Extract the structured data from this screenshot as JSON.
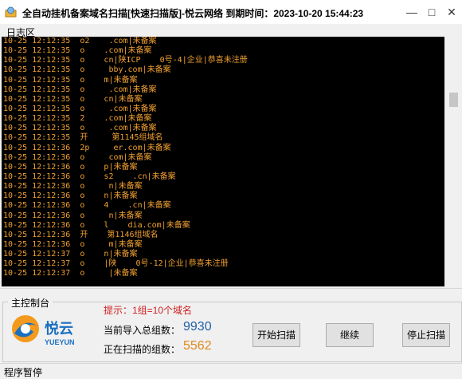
{
  "window": {
    "title": "全自动挂机备案域名扫描[快速扫描版]-悦云网络  到期时间：2023-10-20 15:44:23",
    "minimize": "—",
    "maximize": "□",
    "close": "✕"
  },
  "log_panel": {
    "label": "日志区",
    "lines": [
      "10-25 12:12:35  o2    .com|未备案",
      "10-25 12:12:35  o    .com|未备案",
      "10-25 12:12:35  o    cn|陕ICP    0号-4|企业|恭喜未注册",
      "10-25 12:12:35  o     bby.com|未备案",
      "10-25 12:12:35  o    m|未备案",
      "10-25 12:12:35  o     .com|未备案",
      "10-25 12:12:35  o    cn|未备案",
      "10-25 12:12:35  o     .com|未备案",
      "10-25 12:12:35  2    .com|未备案",
      "10-25 12:12:35  o     .com|未备案",
      "10-25 12:12:35  开     第1145组域名",
      "10-25 12:12:36  2p     er.com|未备案",
      "10-25 12:12:36  o     com|未备案",
      "10-25 12:12:36  o    p|未备案",
      "10-25 12:12:36  o    s2    .cn|未备案",
      "10-25 12:12:36  o     n|未备案",
      "10-25 12:12:36  o    n|未备案",
      "10-25 12:12:36  o    4    .cn|未备案",
      "10-25 12:12:36  o     n|未备案",
      "10-25 12:12:36  o    l    dia.com|未备案",
      "10-25 12:12:36  开    第1146组域名",
      "10-25 12:12:36  o     m|未备案",
      "10-25 12:12:37  o    n|未备案",
      "10-25 12:12:37  o    |陕    0号-12|企业|恭喜未注册",
      "10-25 12:12:37  o     |未备案"
    ]
  },
  "control_panel": {
    "label": "主控制台",
    "logo_text": "悦云",
    "logo_sub": "YUEYUN",
    "hint": "提示：1组=10个域名",
    "total_label": "当前导入总组数：",
    "total_value": "9930",
    "scanning_label": "正在扫描的组数：",
    "scanning_value": "5562",
    "start_button": "开始扫描",
    "continue_button": "继续",
    "stop_button": "停止扫描"
  },
  "status_bar": {
    "text": "程序暂停"
  },
  "colors": {
    "log_text": "#f0a030",
    "log_bg": "#000000",
    "hint": "#d02020",
    "total_value": "#1f5fa8",
    "scanning_value": "#e08a20",
    "logo_blue": "#1a6fc0",
    "logo_orange": "#f39a1e"
  }
}
